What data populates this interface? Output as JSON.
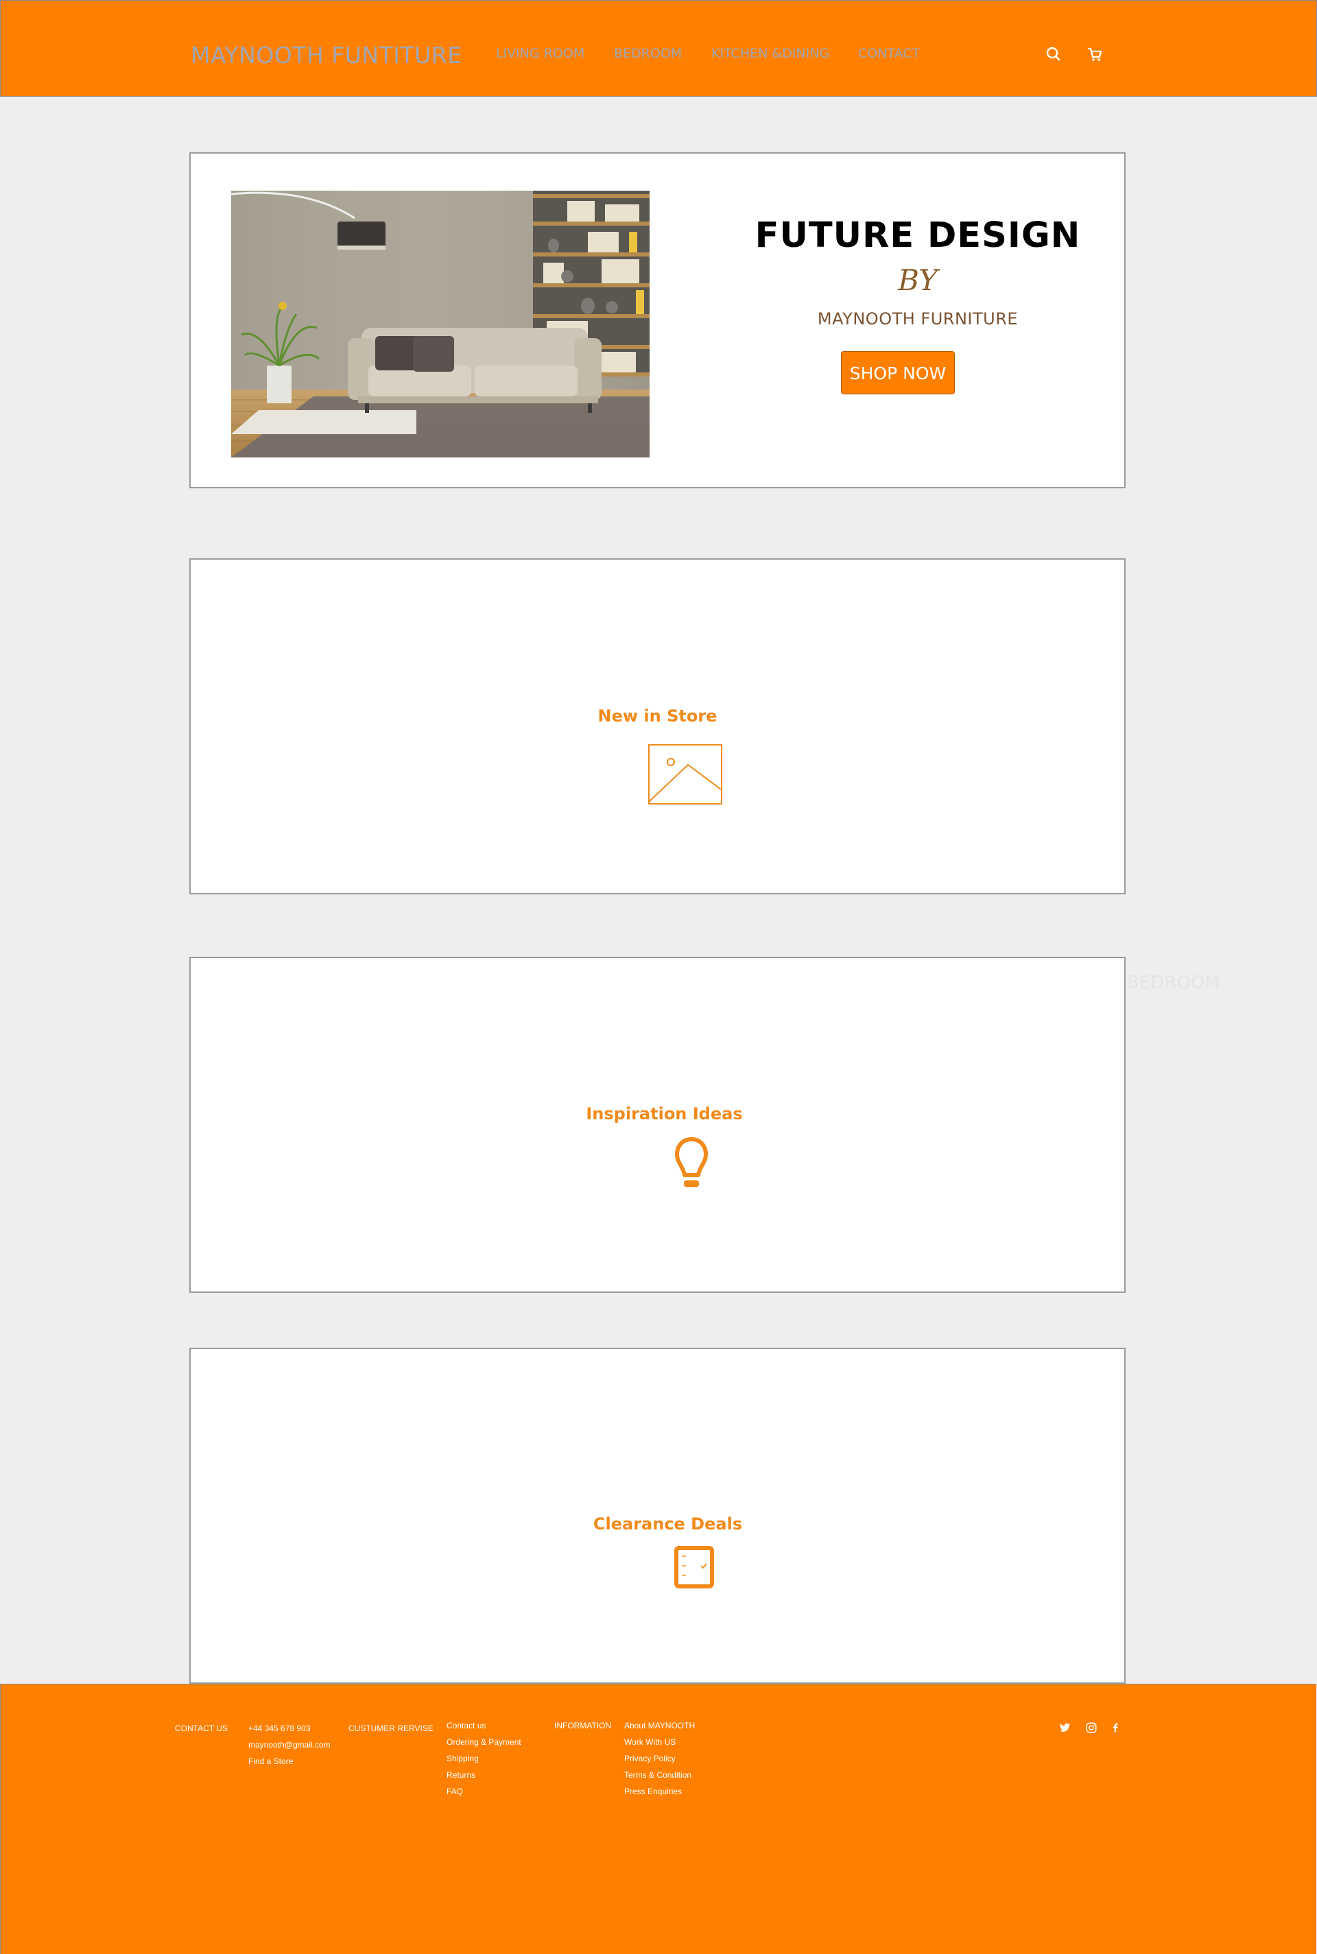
{
  "header": {
    "brand": "MAYNOOTH FUNTITURE",
    "nav": [
      "LIVING ROOM",
      "BEDROOM",
      "KITCHEN &DINING",
      "CONTACT"
    ],
    "icons": [
      "search-icon",
      "cart-icon"
    ]
  },
  "hero": {
    "image": "living-room-sofa-photo",
    "title": "FUTURE DESIGN",
    "by": "BY",
    "subtitle": "MAYNOOTH FURNITURE",
    "button": "SHOP NOW"
  },
  "sections": [
    {
      "title": "New in Store",
      "icon": "image-placeholder-icon"
    },
    {
      "title": "Inspiration Ideas",
      "icon": "lightbulb-icon"
    },
    {
      "title": "Clearance Deals",
      "icon": "checklist-icon"
    }
  ],
  "ghost_text": "BEDROOM",
  "footer": {
    "contact_heading": "CONTACT US",
    "contact_items": [
      "+44 345 678 903",
      "maynooth@gmail.com",
      "Find a Store"
    ],
    "service_heading": "CUSTUMER RERVISE",
    "service_items": [
      "Contact us",
      "Ordering & Payment",
      "Shipping",
      "Returns",
      "FAQ"
    ],
    "info_heading": "INFORMATION",
    "info_items": [
      "About MAYNOOTH",
      "Work With US",
      "Privacy Policy",
      "Terms & Condition",
      "Press Enquiries"
    ],
    "social_icons": [
      "twitter-icon",
      "instagram-icon",
      "facebook-icon"
    ]
  },
  "colors": {
    "brand_orange": "#ff8000",
    "section_title": "#f08a1a",
    "nav_text": "#a1a6b4",
    "page_bg": "#eeeeee"
  }
}
